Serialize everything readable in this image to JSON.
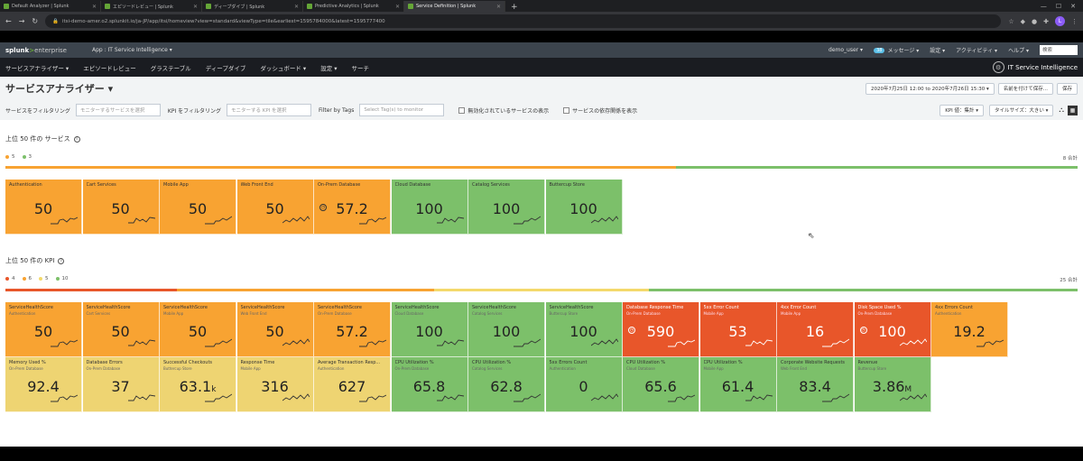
{
  "browser": {
    "tabs": [
      {
        "title": "Default Analyzer | Splunk",
        "color": "#65a637",
        "active": false
      },
      {
        "title": "エピソードレビュー | Splunk",
        "color": "#65a637",
        "active": false
      },
      {
        "title": "ディープダイブ | Splunk",
        "color": "#65a637",
        "active": false
      },
      {
        "title": "Predictive Analytics | Splunk",
        "color": "#65a637",
        "active": false
      },
      {
        "title": "Service Definition | Splunk",
        "color": "#65a637",
        "active": true
      }
    ],
    "new_tab": "+",
    "url": "itsi-demo-amer.o2.splunkit.io/ja-JP/app/itsi/homeview?view=standard&viewType=tile&earliest=1595784000&latest=1595777400"
  },
  "splunk_bar": {
    "logo_main": "splunk",
    "logo_sep": ">",
    "logo_sub": "enterprise",
    "app_label": "App : IT Service Intelligence ▾",
    "user": "demo_user ▾",
    "msg_count": "38",
    "messages": "メッセージ ▾",
    "settings": "設定 ▾",
    "activity": "アクティビティ ▾",
    "help": "ヘルプ ▾",
    "search_placeholder": "検索"
  },
  "nav": {
    "items": [
      "サービスアナライザー ▾",
      "エピソードレビュー",
      "グラステーブル",
      "ディープダイブ",
      "ダッシュボード ▾",
      "設定 ▾",
      "サーチ"
    ],
    "app_name": "IT Service Intelligence"
  },
  "page": {
    "title": "サービスアナライザー ▾",
    "time_range": "2020年7月25日 12:00 to 2020年7月26日 15:30 ▾",
    "save_as": "名前を付けて保存...",
    "save": "保存"
  },
  "filters": {
    "service_label": "サービスをフィルタリング",
    "service_placeholder": "モニターするサービスを選択",
    "kpi_label": "KPI をフィルタリング",
    "kpi_placeholder": "モニターする KPI を選択",
    "tags_label": "Filter by Tags",
    "tags_placeholder": "Select Tag(s) to monitor",
    "show_disabled": "無効化されているサービスの表示",
    "show_deps": "サービスの依存関係を表示",
    "kpi_value": "KPI 値：集計 ▾",
    "tile_size": "タイルサイズ：大きい ▾"
  },
  "services_section": {
    "title": "上位 50 件の サービス",
    "legend": [
      {
        "count": "5",
        "color": "#f8a332"
      },
      {
        "count": "3",
        "color": "#7cc06a"
      }
    ],
    "total": "8 合計",
    "bar": [
      {
        "color": "#f8a332",
        "fraction": 0.625
      },
      {
        "color": "#7cc06a",
        "fraction": 0.375
      }
    ],
    "tiles": [
      {
        "name": "Authentication",
        "value": "50",
        "status": "orange",
        "icon": ""
      },
      {
        "name": "Cart Services",
        "value": "50",
        "status": "orange",
        "icon": ""
      },
      {
        "name": "Mobile App",
        "value": "50",
        "status": "orange",
        "icon": ""
      },
      {
        "name": "Web Front End",
        "value": "50",
        "status": "orange",
        "icon": ""
      },
      {
        "name": "On-Prem Database",
        "value": "57.2",
        "status": "orange",
        "icon": "clock-icon"
      },
      {
        "name": "Cloud Database",
        "value": "100",
        "status": "green",
        "icon": ""
      },
      {
        "name": "Catalog Services",
        "value": "100",
        "status": "green",
        "icon": ""
      },
      {
        "name": "Buttercup Store",
        "value": "100",
        "status": "green",
        "icon": ""
      }
    ]
  },
  "kpi_section": {
    "title": "上位 50 件の KPI",
    "legend": [
      {
        "count": "4",
        "color": "#e8562a"
      },
      {
        "count": "6",
        "color": "#f8a332"
      },
      {
        "count": "5",
        "color": "#f4d96b"
      },
      {
        "count": "10",
        "color": "#7cc06a"
      }
    ],
    "total": "25 合計",
    "bar": [
      {
        "color": "#e8562a",
        "fraction": 0.16
      },
      {
        "color": "#f8a332",
        "fraction": 0.24
      },
      {
        "color": "#f4d96b",
        "fraction": 0.2
      },
      {
        "color": "#7cc06a",
        "fraction": 0.4
      }
    ],
    "rows": [
      [
        {
          "name": "ServiceHealthScore",
          "sub": "Authentication",
          "value": "50",
          "unit": "",
          "status": "orange",
          "icon": ""
        },
        {
          "name": "ServiceHealthScore",
          "sub": "Cart Services",
          "value": "50",
          "unit": "",
          "status": "orange",
          "icon": ""
        },
        {
          "name": "ServiceHealthScore",
          "sub": "Mobile App",
          "value": "50",
          "unit": "",
          "status": "orange",
          "icon": ""
        },
        {
          "name": "ServiceHealthScore",
          "sub": "Web Front End",
          "value": "50",
          "unit": "",
          "status": "orange",
          "icon": ""
        },
        {
          "name": "ServiceHealthScore",
          "sub": "On-Prem Database",
          "value": "57.2",
          "unit": "",
          "status": "orange",
          "icon": ""
        },
        {
          "name": "ServiceHealthScore",
          "sub": "Cloud Database",
          "value": "100",
          "unit": "",
          "status": "green",
          "icon": ""
        },
        {
          "name": "ServiceHealthScore",
          "sub": "Catalog Services",
          "value": "100",
          "unit": "",
          "status": "green",
          "icon": ""
        },
        {
          "name": "ServiceHealthScore",
          "sub": "Buttercup Store",
          "value": "100",
          "unit": "",
          "status": "green",
          "icon": ""
        },
        {
          "name": "Database Response Time",
          "sub": "On-Prem Database",
          "value": "590",
          "unit": "",
          "status": "red",
          "icon": "clock-icon"
        },
        {
          "name": "5xx Error Count",
          "sub": "Mobile App",
          "value": "53",
          "unit": "",
          "status": "red",
          "icon": ""
        },
        {
          "name": "4xx Error Count",
          "sub": "Mobile App",
          "value": "16",
          "unit": "",
          "status": "red",
          "icon": ""
        },
        {
          "name": "Disk Space Used %",
          "sub": "On-Prem Database",
          "value": "100",
          "unit": "",
          "status": "red",
          "icon": "clock-icon"
        },
        {
          "name": "4xx Errors Count",
          "sub": "Authentication",
          "value": "19.2",
          "unit": "",
          "status": "orange",
          "icon": ""
        }
      ],
      [
        {
          "name": "Memory Used %",
          "sub": "On-Prem Database",
          "value": "92.4",
          "unit": "",
          "status": "yellow",
          "icon": ""
        },
        {
          "name": "Database Errors",
          "sub": "On-Prem Database",
          "value": "37",
          "unit": "",
          "status": "yellow",
          "icon": ""
        },
        {
          "name": "Successful Checkouts",
          "sub": "Buttercup Store",
          "value": "63.1",
          "unit": "k",
          "status": "yellow",
          "icon": ""
        },
        {
          "name": "Response Time",
          "sub": "Mobile App",
          "value": "316",
          "unit": "",
          "status": "yellow",
          "icon": ""
        },
        {
          "name": "Average Transaction Resp...",
          "sub": "Authentication",
          "value": "627",
          "unit": "",
          "status": "yellow",
          "icon": ""
        },
        {
          "name": "CPU Utilization %",
          "sub": "On-Prem Database",
          "value": "65.8",
          "unit": "",
          "status": "green",
          "icon": ""
        },
        {
          "name": "CPU Utilization %",
          "sub": "Catalog Services",
          "value": "62.8",
          "unit": "",
          "status": "green",
          "icon": ""
        },
        {
          "name": "5xx Errors Count",
          "sub": "Authentication",
          "value": "0",
          "unit": "",
          "status": "green",
          "icon": ""
        },
        {
          "name": "CPU Utilization %",
          "sub": "Cloud Database",
          "value": "65.6",
          "unit": "",
          "status": "green",
          "icon": ""
        },
        {
          "name": "CPU Utilization %",
          "sub": "Mobile App",
          "value": "61.4",
          "unit": "",
          "status": "green",
          "icon": ""
        },
        {
          "name": "Corporate Website Requests",
          "sub": "Web Front End",
          "value": "83.4",
          "unit": "",
          "status": "green",
          "icon": ""
        },
        {
          "name": "Revenue",
          "sub": "Buttercup Store",
          "value": "3.86",
          "unit": "M",
          "status": "green",
          "icon": ""
        }
      ]
    ]
  },
  "colors": {
    "orange": "#f8a332",
    "green": "#7cc06a",
    "yellow": "#eed472",
    "red": "#e8562a"
  }
}
